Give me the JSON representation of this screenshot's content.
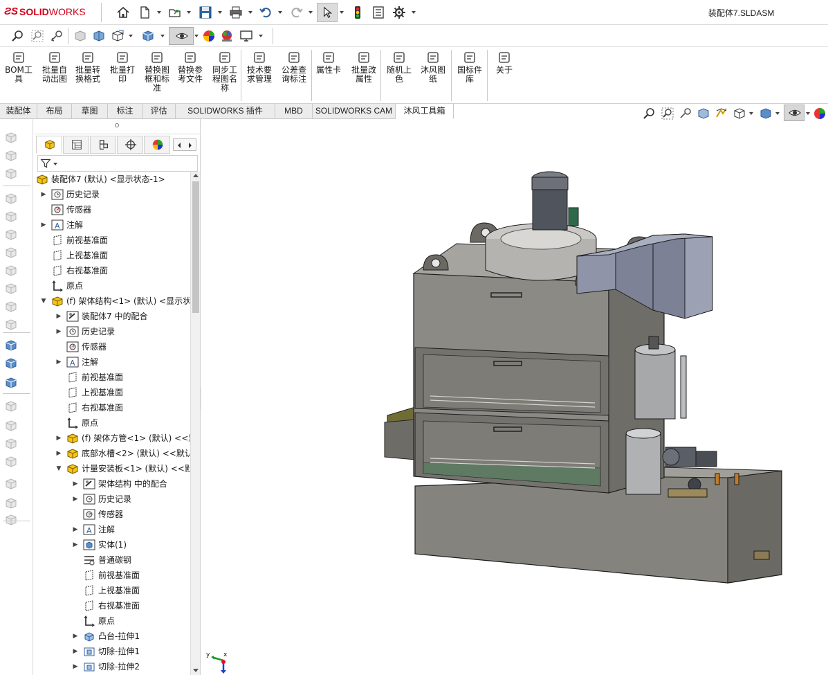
{
  "app": {
    "logo_text_prefix": "SOLID",
    "logo_text_suffix": "WORKS",
    "document_title": "装配体7.SLDASM"
  },
  "ribbon": {
    "buttons": [
      {
        "label": "BOM工具",
        "icon": "bom-icon"
      },
      {
        "label": "批量自动出图",
        "icon": "batch-drawing-icon"
      },
      {
        "label": "批量转换格式",
        "icon": "convert-format-icon"
      },
      {
        "label": "批量打印",
        "icon": "print-icon"
      },
      {
        "label": "替换图框和标准",
        "icon": "replace-frame-icon"
      },
      {
        "label": "替换参考文件",
        "icon": "replace-reference-icon"
      },
      {
        "label": "同步工程图名称",
        "icon": "sync-name-icon"
      },
      {
        "label": "技术要求管理",
        "icon": "tech-req-icon"
      },
      {
        "label": "公差查询标注",
        "icon": "tolerance-icon"
      },
      {
        "label": "属性卡",
        "icon": "property-card-icon"
      },
      {
        "label": "批量改属性",
        "icon": "batch-property-icon"
      },
      {
        "label": "随机上色",
        "icon": "random-color-icon"
      },
      {
        "label": "沐风图纸",
        "icon": "mufeng-drawing-icon"
      },
      {
        "label": "国标件库",
        "icon": "standard-parts-icon"
      },
      {
        "label": "关于",
        "icon": "about-icon"
      }
    ]
  },
  "tabs": [
    {
      "label": "装配体"
    },
    {
      "label": "布局"
    },
    {
      "label": "草图"
    },
    {
      "label": "标注"
    },
    {
      "label": "评估"
    },
    {
      "label": "SOLIDWORKS 插件"
    },
    {
      "label": "MBD"
    },
    {
      "label": "SOLIDWORKS CAM"
    },
    {
      "label": "沐风工具箱"
    }
  ],
  "active_tab": "沐风工具箱",
  "tree": [
    {
      "level": 0,
      "arrow": "",
      "icon": "assembly-icon",
      "label": "装配体7 (默认) <显示状态-1>"
    },
    {
      "level": 1,
      "arrow": "right",
      "icon": "history-icon",
      "label": "历史记录"
    },
    {
      "level": 1,
      "arrow": "",
      "icon": "sensor-icon",
      "label": "传感器"
    },
    {
      "level": 1,
      "arrow": "right",
      "icon": "annotation-icon",
      "label": "注解"
    },
    {
      "level": 1,
      "arrow": "",
      "icon": "plane-icon",
      "label": "前视基准面"
    },
    {
      "level": 1,
      "arrow": "",
      "icon": "plane-icon",
      "label": "上视基准面"
    },
    {
      "level": 1,
      "arrow": "",
      "icon": "plane-icon",
      "label": "右视基准面"
    },
    {
      "level": 1,
      "arrow": "",
      "icon": "origin-icon",
      "label": "原点"
    },
    {
      "level": 1,
      "arrow": "down",
      "icon": "subassembly-icon",
      "label": "(f) 架体结构<1> (默认) <显示状"
    },
    {
      "level": 2,
      "arrow": "right",
      "icon": "mates-icon",
      "label": "装配体7 中的配合"
    },
    {
      "level": 2,
      "arrow": "right",
      "icon": "history-icon",
      "label": "历史记录"
    },
    {
      "level": 2,
      "arrow": "",
      "icon": "sensor-icon",
      "label": "传感器"
    },
    {
      "level": 2,
      "arrow": "right",
      "icon": "annotation-icon",
      "label": "注解"
    },
    {
      "level": 2,
      "arrow": "",
      "icon": "plane-icon",
      "label": "前视基准面"
    },
    {
      "level": 2,
      "arrow": "",
      "icon": "plane-icon",
      "label": "上视基准面"
    },
    {
      "level": 2,
      "arrow": "",
      "icon": "plane-icon",
      "label": "右视基准面"
    },
    {
      "level": 2,
      "arrow": "",
      "icon": "origin-icon",
      "label": "原点"
    },
    {
      "level": 2,
      "arrow": "right",
      "icon": "part-icon",
      "label": "(f) 架体方管<1> (默认) <<默"
    },
    {
      "level": 2,
      "arrow": "right",
      "icon": "part-icon",
      "label": "底部水槽<2> (默认) <<默认"
    },
    {
      "level": 2,
      "arrow": "down",
      "icon": "part-icon",
      "label": "计量安装板<1> (默认) <<默"
    },
    {
      "level": 3,
      "arrow": "right",
      "icon": "mates-icon",
      "label": "架体结构 中的配合"
    },
    {
      "level": 3,
      "arrow": "right",
      "icon": "history-icon",
      "label": "历史记录"
    },
    {
      "level": 3,
      "arrow": "",
      "icon": "sensor-icon",
      "label": "传感器"
    },
    {
      "level": 3,
      "arrow": "right",
      "icon": "annotation-icon",
      "label": "注解"
    },
    {
      "level": 3,
      "arrow": "right",
      "icon": "solid-body-icon",
      "label": "实体(1)"
    },
    {
      "level": 3,
      "arrow": "",
      "icon": "material-icon",
      "label": "普通碳钢"
    },
    {
      "level": 3,
      "arrow": "",
      "icon": "plane-icon",
      "label": "前视基准面"
    },
    {
      "level": 3,
      "arrow": "",
      "icon": "plane-icon",
      "label": "上视基准面"
    },
    {
      "level": 3,
      "arrow": "",
      "icon": "plane-icon",
      "label": "右视基准面"
    },
    {
      "level": 3,
      "arrow": "",
      "icon": "origin-icon",
      "label": "原点"
    },
    {
      "level": 3,
      "arrow": "right",
      "icon": "boss-extrude-icon",
      "label": "凸台-拉伸1"
    },
    {
      "level": 3,
      "arrow": "right",
      "icon": "cut-extrude-icon",
      "label": "切除-拉伸1"
    },
    {
      "level": 3,
      "arrow": "right",
      "icon": "cut-extrude-icon",
      "label": "切除-拉伸2"
    }
  ],
  "colors": {
    "brand": "#d0021b",
    "model_body": "#8c8a85",
    "model_shade": "#5f5d59",
    "model_light": "#b2b0ab",
    "duct": "#8f94a8",
    "tank": "#a7a8aa",
    "glass": "#6c6b67"
  }
}
